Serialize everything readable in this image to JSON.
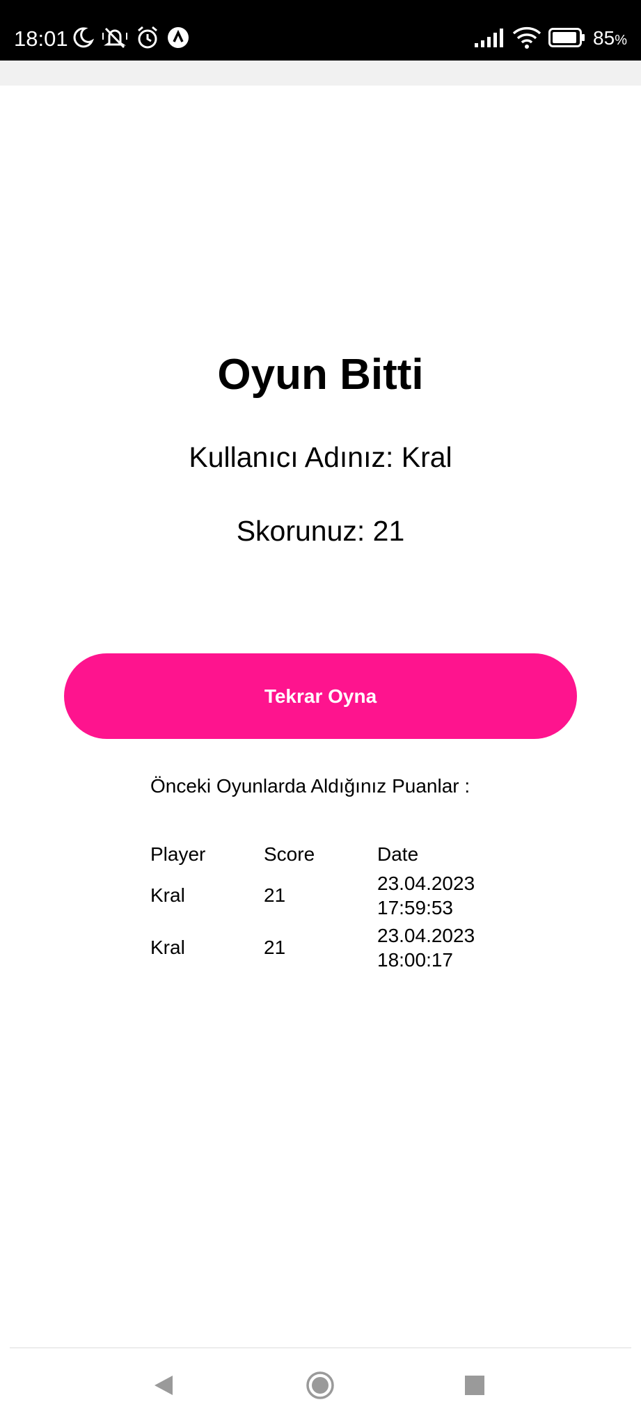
{
  "status_bar": {
    "time": "18:01",
    "battery_value": "85",
    "battery_unit": "%",
    "icons_left": [
      "moon-icon",
      "notifications-off-icon",
      "alarm-icon",
      "app-notification-icon"
    ],
    "icons_right": [
      "signal-icon",
      "wifi-icon",
      "battery-icon"
    ]
  },
  "main": {
    "title": "Oyun Bitti",
    "username_text": "Kullanıcı Adınız: Kral",
    "score_text": "Skorunuz: 21",
    "replay_button_label": "Tekrar Oyna",
    "history_label": "Önceki Oyunlarda Aldığınız Puanlar :"
  },
  "history_table": {
    "headers": {
      "player": "Player",
      "score": "Score",
      "date": "Date"
    },
    "rows": [
      {
        "player": "Kral",
        "score": "21",
        "date": "23.04.2023",
        "time": "17:59:53"
      },
      {
        "player": "Kral",
        "score": "21",
        "date": "23.04.2023",
        "time": "18:00:17"
      }
    ]
  },
  "colors": {
    "accent": "#fe148e",
    "status_bar": "#000000",
    "strip": "#f1f1f1"
  },
  "nav_bar": {
    "buttons": [
      "back-icon",
      "home-icon",
      "recents-icon"
    ]
  }
}
